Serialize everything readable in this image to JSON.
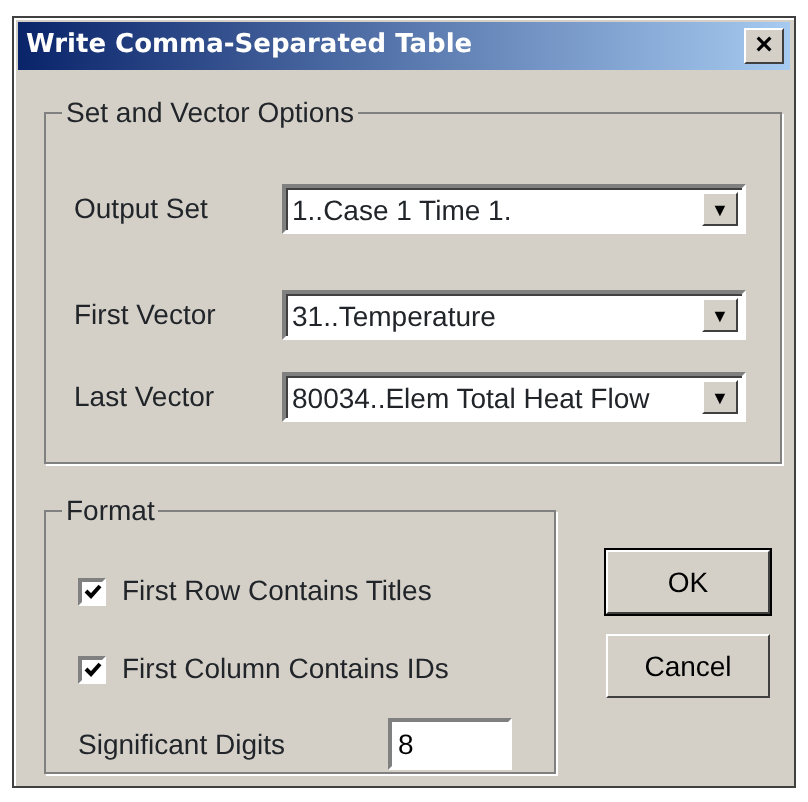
{
  "window": {
    "title": "Write Comma-Separated Table",
    "close": "×"
  },
  "set_and_vector_options": {
    "legend": "Set and Vector Options",
    "fields": [
      {
        "label": "Output Set",
        "value": "1..Case 1 Time 1.",
        "arrow": "▼"
      },
      {
        "label": "First Vector",
        "value": "31..Temperature",
        "arrow": "▼"
      },
      {
        "label": "Last Vector",
        "value": "80034..Elem Total Heat Flow",
        "arrow": "▼"
      }
    ]
  },
  "format": {
    "legend": "Format",
    "checkboxes": [
      {
        "label": "First Row Contains Titles",
        "checked": true
      },
      {
        "label": "First Column Contains IDs",
        "checked": true
      }
    ],
    "significant_digits": {
      "label": "Significant Digits",
      "value": "8"
    }
  },
  "buttons": [
    {
      "label": "OK",
      "default": true
    },
    {
      "label": "Cancel",
      "default": false
    }
  ]
}
